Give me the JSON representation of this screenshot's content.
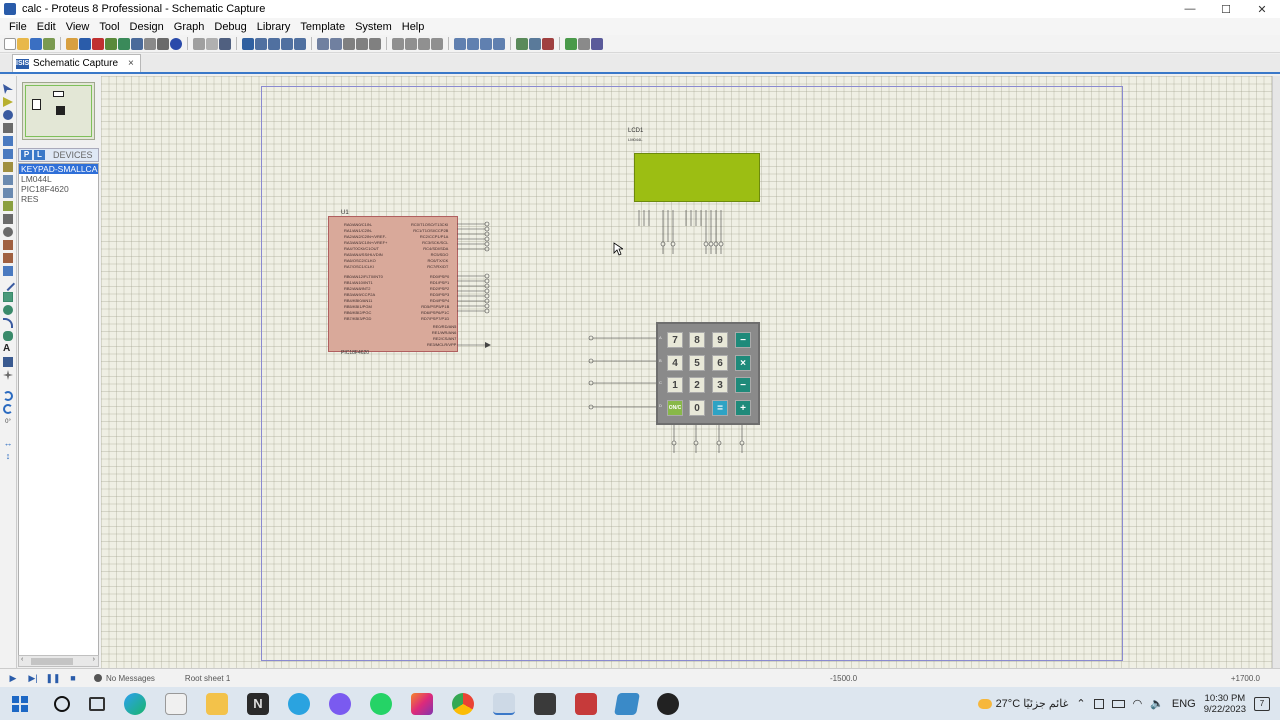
{
  "window": {
    "title": "calc - Proteus 8 Professional - Schematic Capture",
    "min": "—",
    "max": "☐",
    "close": "✕"
  },
  "menu": [
    "File",
    "Edit",
    "View",
    "Tool",
    "Design",
    "Graph",
    "Debug",
    "Library",
    "Template",
    "System",
    "Help"
  ],
  "tab": {
    "icon_text": "ISIS",
    "label": "Schematic Capture",
    "close": "×"
  },
  "devices": {
    "p_button": "P",
    "l_button": "L",
    "title": "DEVICES",
    "items": [
      "KEYPAD-SMALLCALC",
      "LM044L",
      "PIC18F4620",
      "RES"
    ],
    "selected_index": 0
  },
  "schematic": {
    "mcu": {
      "ref": "U1",
      "part": "PIC18F4620"
    },
    "lcd": {
      "ref": "LCD1",
      "part": "LM044L"
    },
    "keypad": {
      "keys": [
        [
          "7",
          "8",
          "9",
          "−"
        ],
        [
          "4",
          "5",
          "6",
          "×"
        ],
        [
          "1",
          "2",
          "3",
          "−"
        ],
        [
          "ON/C",
          "0",
          "=",
          "+"
        ]
      ],
      "row_labels": [
        "A",
        "B",
        "C",
        "D"
      ]
    }
  },
  "status": {
    "messages": "No Messages",
    "sheet": "Root sheet 1",
    "coord_x": "-1500.0",
    "coord_y": "+1700.0"
  },
  "taskbar": {
    "weather": "27°C  غائم جزئيًا",
    "lang": "ENG",
    "time": "10:30 PM",
    "date": "9/22/2023",
    "notification_count": "7"
  },
  "colors": {
    "lcd": "#9cbe13",
    "mcu": "#d9a99a",
    "keypad_op": "#1f8a7a",
    "accent": "#3a78c8"
  }
}
